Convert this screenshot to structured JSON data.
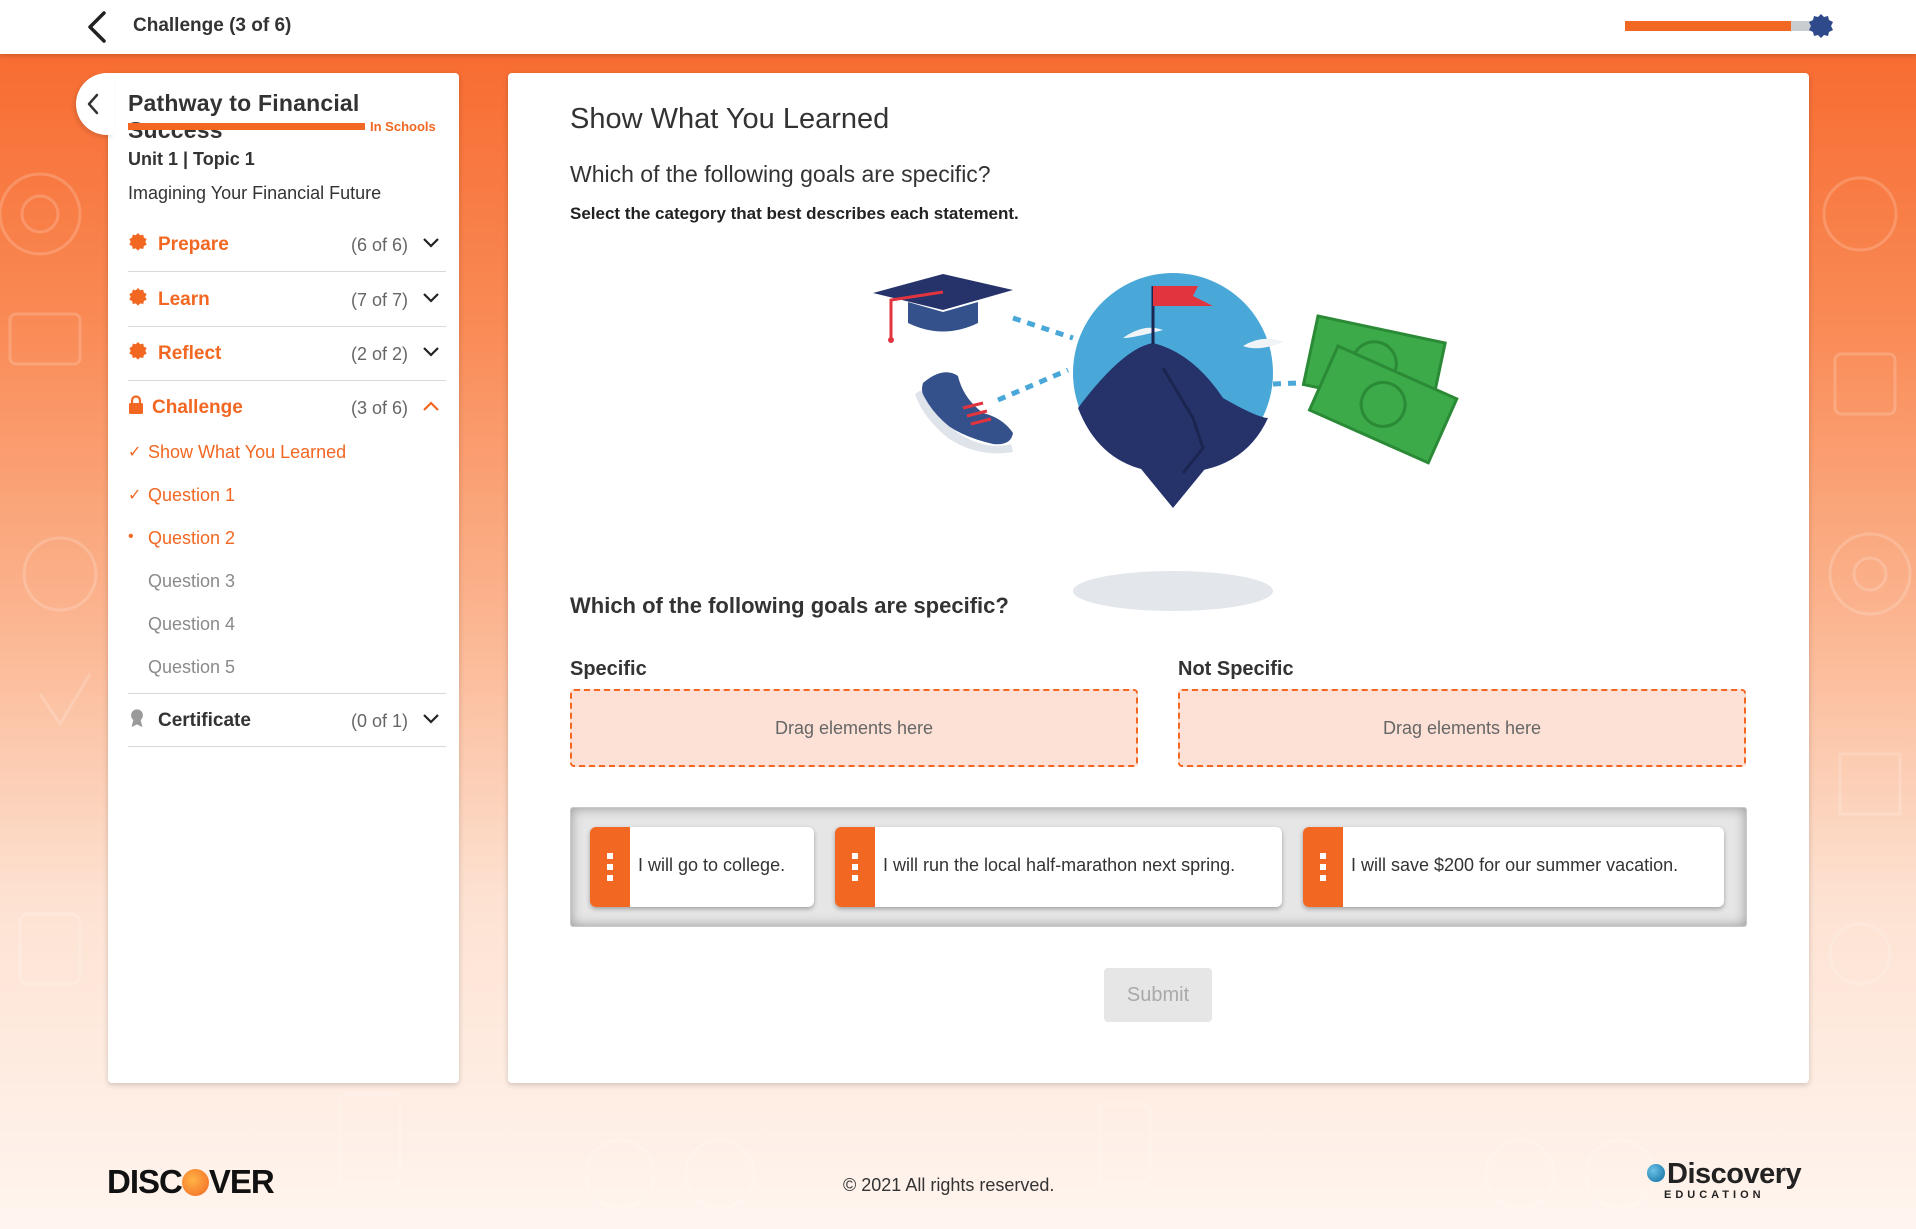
{
  "topbar": {
    "title": "Challenge (3 of 6)",
    "progress": 0.83
  },
  "sidebar": {
    "logo_title": "Pathway to Financial Success",
    "logo_sub": "In Schools",
    "unit": "Unit 1 | Topic 1",
    "topic_title": "Imagining Your Financial Future",
    "sections": [
      {
        "label": "Prepare",
        "count": "(6 of 6)",
        "icon": "badge-icon",
        "expanded": false
      },
      {
        "label": "Learn",
        "count": "(7 of 7)",
        "icon": "badge-icon",
        "expanded": false
      },
      {
        "label": "Reflect",
        "count": "(2 of 2)",
        "icon": "badge-icon",
        "expanded": false
      },
      {
        "label": "Challenge",
        "count": "(3 of 6)",
        "icon": "lock-icon",
        "expanded": true
      },
      {
        "label": "Certificate",
        "count": "(0 of 1)",
        "icon": "award-icon",
        "expanded": false
      }
    ],
    "challenge_items": [
      {
        "label": "Show What You Learned",
        "state": "done",
        "mark": "✓"
      },
      {
        "label": "Question 1",
        "state": "done",
        "mark": "✓"
      },
      {
        "label": "Question 2",
        "state": "current",
        "mark": "•"
      },
      {
        "label": "Question 3",
        "state": "todo",
        "mark": ""
      },
      {
        "label": "Question 4",
        "state": "todo",
        "mark": ""
      },
      {
        "label": "Question 5",
        "state": "todo",
        "mark": ""
      }
    ]
  },
  "main": {
    "title": "Show What You Learned",
    "question": "Which of the following goals are specific?",
    "instruction": "Select the category that best describes each statement.",
    "question2": "Which of the following goals are specific?",
    "zones": [
      {
        "label": "Specific",
        "placeholder": "Drag elements here"
      },
      {
        "label": "Not Specific",
        "placeholder": "Drag elements here"
      }
    ],
    "cards": [
      "I will go to college.",
      "I will run the local half-marathon next spring.",
      "I will save $200 for our summer vacation."
    ],
    "submit_label": "Submit"
  },
  "footer": {
    "discover_left": "DISC",
    "discover_right": "VER",
    "copyright": "© 2021 All rights reserved.",
    "de_word": "Discovery",
    "de_sub": "EDUCATION"
  },
  "colors": {
    "accent": "#f26722",
    "dropzone_bg": "#fde1d6",
    "navy": "#26336b",
    "sky": "#4aa8d8",
    "money": "#3daa4a"
  }
}
